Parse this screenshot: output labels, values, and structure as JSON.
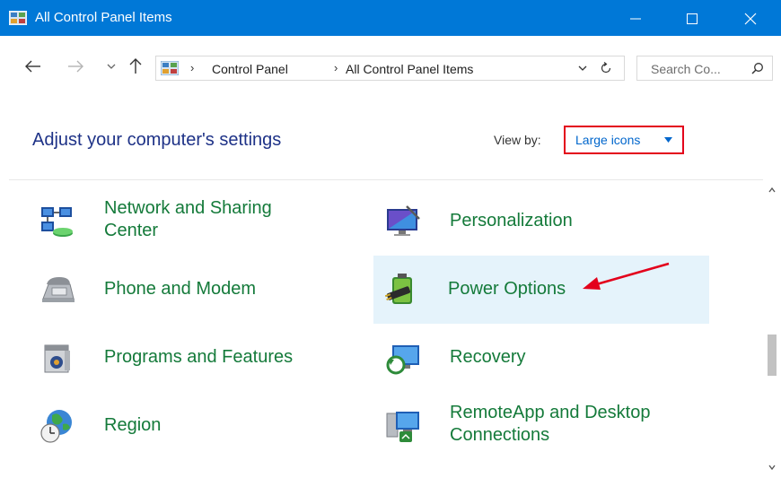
{
  "window": {
    "title": "All Control Panel Items",
    "controls": [
      "minimize",
      "maximize",
      "close"
    ]
  },
  "navigation": {
    "breadcrumbs": [
      "Control Panel",
      "All Control Panel Items"
    ],
    "search_placeholder": "Search Co..."
  },
  "header": {
    "title": "Adjust your computer's settings",
    "view_by_label": "View by:",
    "view_by_value": "Large icons"
  },
  "items": [
    {
      "label_line1": "Network and Sharing",
      "label_line2": "Center",
      "icon": "network-sharing-icon"
    },
    {
      "label_line1": "Personalization",
      "label_line2": "",
      "icon": "personalization-icon"
    },
    {
      "label_line1": "Phone and Modem",
      "label_line2": "",
      "icon": "phone-modem-icon"
    },
    {
      "label_line1": "Power Options",
      "label_line2": "",
      "icon": "power-options-icon",
      "highlighted": true
    },
    {
      "label_line1": "Programs and Features",
      "label_line2": "",
      "icon": "programs-features-icon"
    },
    {
      "label_line1": "Recovery",
      "label_line2": "",
      "icon": "recovery-icon"
    },
    {
      "label_line1": "Region",
      "label_line2": "",
      "icon": "region-icon"
    },
    {
      "label_line1": "RemoteApp and Desktop",
      "label_line2": "Connections",
      "icon": "remoteapp-icon"
    }
  ],
  "colors": {
    "titlebar": "#0078d7",
    "link_green": "#147a3a",
    "heading_blue": "#1e3287",
    "highlight_bg": "#e5f3fb",
    "annotation_red": "#e3001b"
  }
}
